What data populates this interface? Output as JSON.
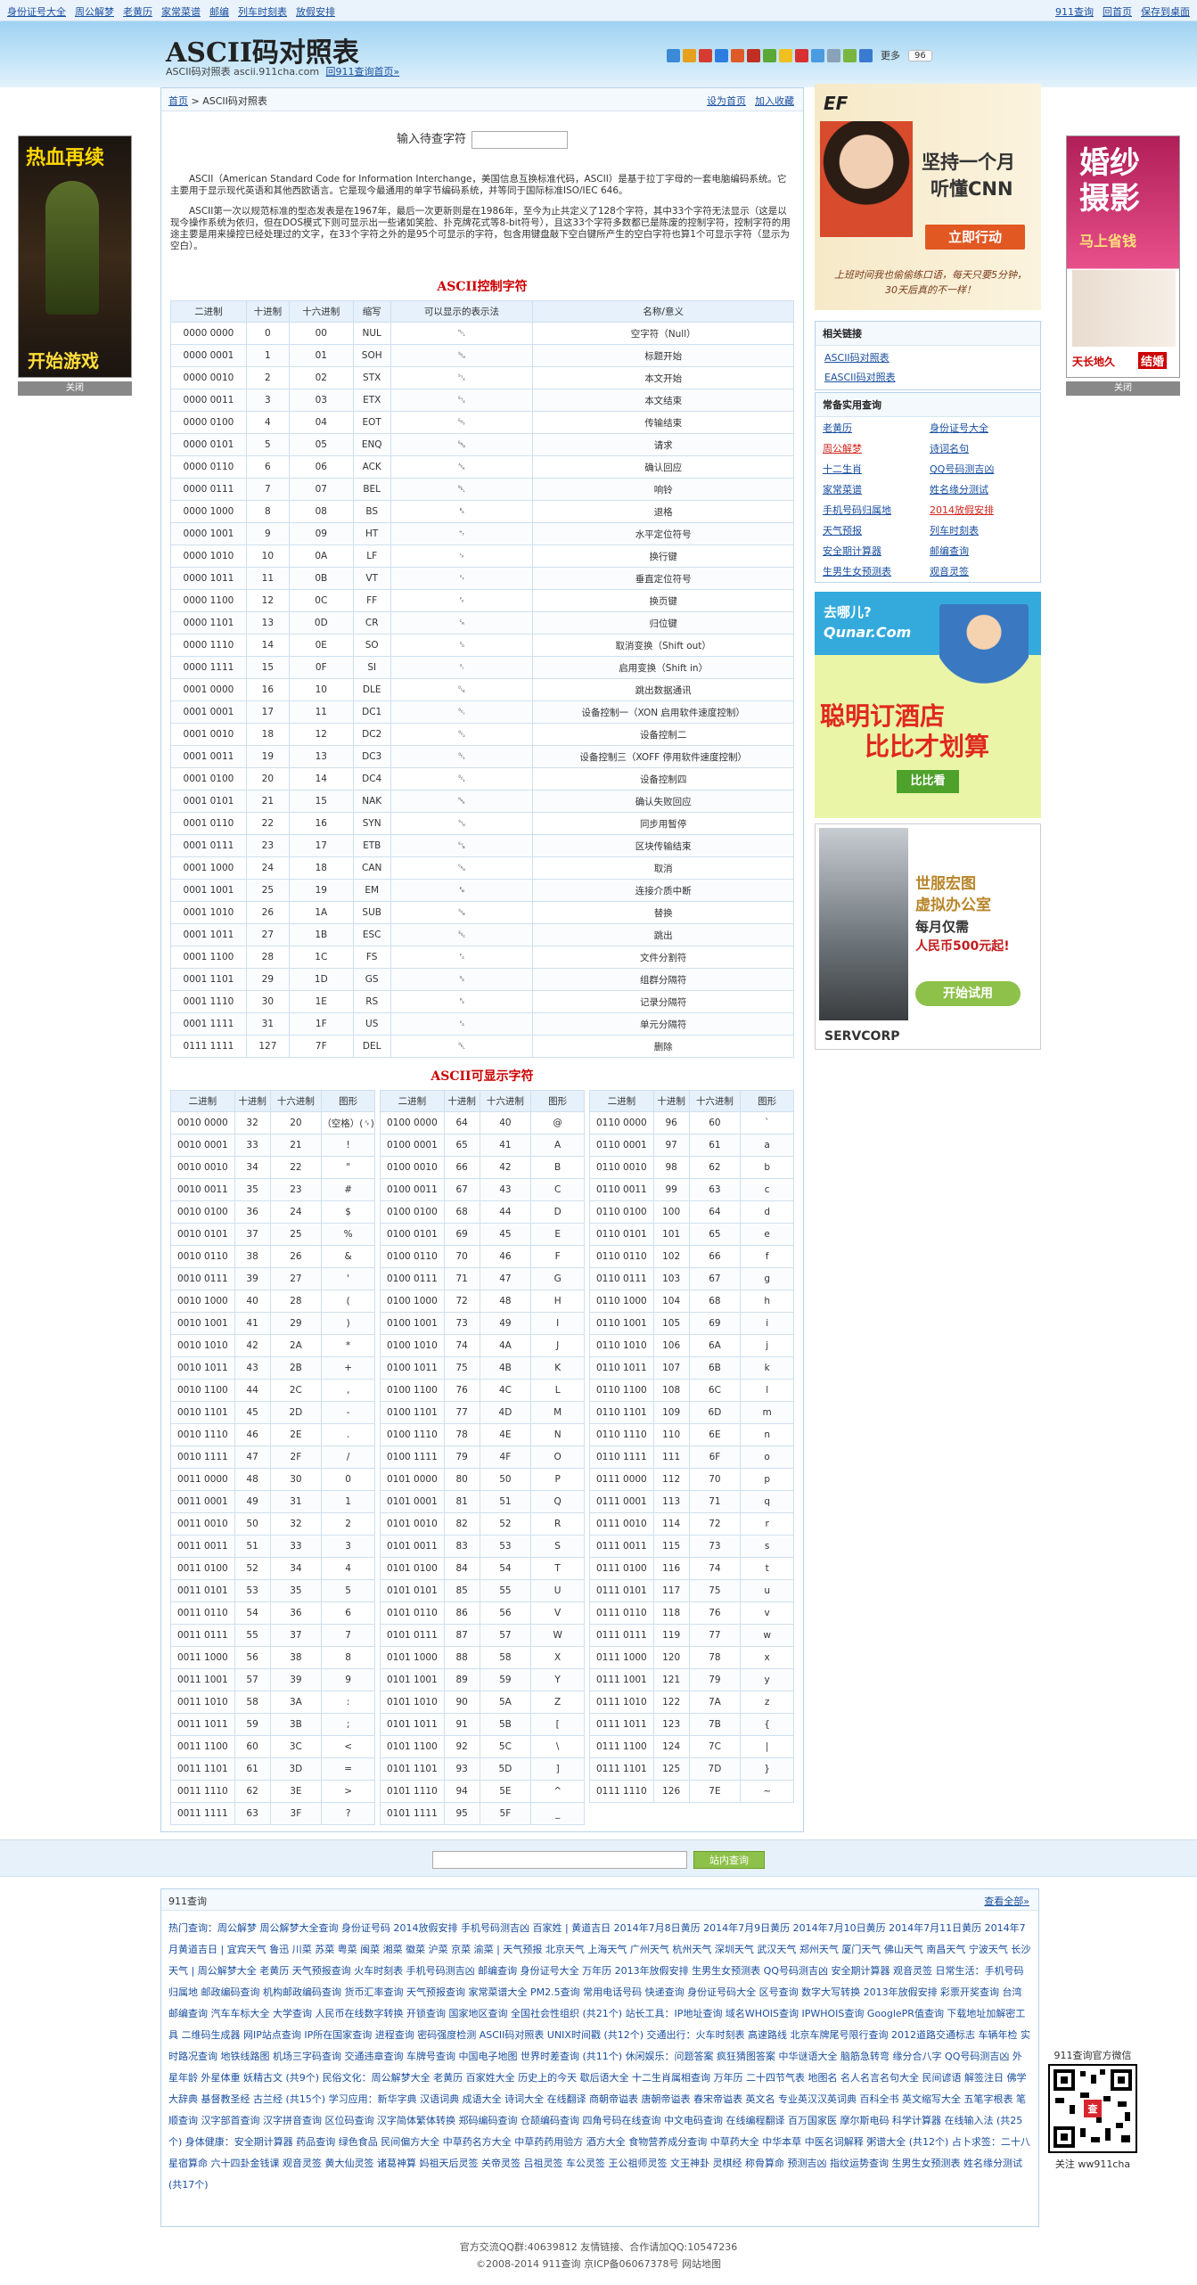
{
  "topbar": {
    "left_links": [
      "身份证号大全",
      "周公解梦",
      "老黄历",
      "家常菜谱",
      "邮编",
      "列车时刻表",
      "放假安排"
    ],
    "right_links": [
      "911查询",
      "回首页",
      "保存到桌面"
    ]
  },
  "header": {
    "title": "ASCII码对照表",
    "subtitle": "ASCII码对照表 ascii.911cha.com",
    "subtitle_link": "回911查询首页»",
    "more_label": "更多",
    "share_count": "96"
  },
  "crumb": {
    "home": "首页",
    "current": " > ASCII码对照表",
    "set_home": "设为首页",
    "favorite": "加入收藏"
  },
  "input": {
    "label": "输入待查字符",
    "value": ""
  },
  "intro": [
    "ASCII（American Standard Code for Information Interchange，美国信息互换标准代码，ASCII）是基于拉丁字母的一套电脑编码系统。它主要用于显示现代英语和其他西欧语言。它是现今最通用的单字节编码系统，并等同于国际标准ISO/IEC 646。",
    "ASCII第一次以规范标准的型态发表是在1967年，最后一次更新则是在1986年，至今为止共定义了128个字符，其中33个字符无法显示（这是以现今操作系统为依归，但在DOS模式下则可显示出一些诸如笑脸、扑克牌花式等8-bit符号），且这33个字符多数都已是陈废的控制字符，控制字符的用途主要是用来操控已经处理过的文字，在33个字符之外的是95个可显示的字符，包含用键盘敲下空白键所产生的空白字符也算1个可显示字符（显示为空白）。"
  ],
  "control": {
    "title": "ASCII控制字符",
    "headers": [
      "二进制",
      "十进制",
      "十六进制",
      "缩写",
      "可以显示的表示法",
      "名称/意义"
    ],
    "rows": [
      [
        "0000 0000",
        "0",
        "00",
        "NUL",
        "␀",
        "空字符（Null）"
      ],
      [
        "0000 0001",
        "1",
        "01",
        "SOH",
        "␁",
        "标题开始"
      ],
      [
        "0000 0010",
        "2",
        "02",
        "STX",
        "␂",
        "本文开始"
      ],
      [
        "0000 0011",
        "3",
        "03",
        "ETX",
        "␃",
        "本文结束"
      ],
      [
        "0000 0100",
        "4",
        "04",
        "EOT",
        "␄",
        "传输结束"
      ],
      [
        "0000 0101",
        "5",
        "05",
        "ENQ",
        "␅",
        "请求"
      ],
      [
        "0000 0110",
        "6",
        "06",
        "ACK",
        "␆",
        "确认回应"
      ],
      [
        "0000 0111",
        "7",
        "07",
        "BEL",
        "␇",
        "响铃"
      ],
      [
        "0000 1000",
        "8",
        "08",
        "BS",
        "␈",
        "退格"
      ],
      [
        "0000 1001",
        "9",
        "09",
        "HT",
        "␉",
        "水平定位符号"
      ],
      [
        "0000 1010",
        "10",
        "0A",
        "LF",
        "␊",
        "换行键"
      ],
      [
        "0000 1011",
        "11",
        "0B",
        "VT",
        "␋",
        "垂直定位符号"
      ],
      [
        "0000 1100",
        "12",
        "0C",
        "FF",
        "␌",
        "换页键"
      ],
      [
        "0000 1101",
        "13",
        "0D",
        "CR",
        "␍",
        "归位键"
      ],
      [
        "0000 1110",
        "14",
        "0E",
        "SO",
        "␎",
        "取消变换（Shift out）"
      ],
      [
        "0000 1111",
        "15",
        "0F",
        "SI",
        "␏",
        "启用变换（Shift in）"
      ],
      [
        "0001 0000",
        "16",
        "10",
        "DLE",
        "␐",
        "跳出数据通讯"
      ],
      [
        "0001 0001",
        "17",
        "11",
        "DC1",
        "␑",
        "设备控制一（XON 启用软件速度控制）"
      ],
      [
        "0001 0010",
        "18",
        "12",
        "DC2",
        "␒",
        "设备控制二"
      ],
      [
        "0001 0011",
        "19",
        "13",
        "DC3",
        "␓",
        "设备控制三（XOFF 停用软件速度控制）"
      ],
      [
        "0001 0100",
        "20",
        "14",
        "DC4",
        "␔",
        "设备控制四"
      ],
      [
        "0001 0101",
        "21",
        "15",
        "NAK",
        "␕",
        "确认失败回应"
      ],
      [
        "0001 0110",
        "22",
        "16",
        "SYN",
        "␖",
        "同步用暂停"
      ],
      [
        "0001 0111",
        "23",
        "17",
        "ETB",
        "␗",
        "区块传输结束"
      ],
      [
        "0001 1000",
        "24",
        "18",
        "CAN",
        "␘",
        "取消"
      ],
      [
        "0001 1001",
        "25",
        "19",
        "EM",
        "␙",
        "连接介质中断"
      ],
      [
        "0001 1010",
        "26",
        "1A",
        "SUB",
        "␚",
        "替换"
      ],
      [
        "0001 1011",
        "27",
        "1B",
        "ESC",
        "␛",
        "跳出"
      ],
      [
        "0001 1100",
        "28",
        "1C",
        "FS",
        "␜",
        "文件分割符"
      ],
      [
        "0001 1101",
        "29",
        "1D",
        "GS",
        "␝",
        "组群分隔符"
      ],
      [
        "0001 1110",
        "30",
        "1E",
        "RS",
        "␞",
        "记录分隔符"
      ],
      [
        "0001 1111",
        "31",
        "1F",
        "US",
        "␟",
        "单元分隔符"
      ],
      [
        "0111 1111",
        "127",
        "7F",
        "DEL",
        "␡",
        "删除"
      ]
    ]
  },
  "printable": {
    "title": "ASCII可显示字符",
    "headers": [
      "二进制",
      "十进制",
      "十六进制",
      "图形"
    ],
    "col1": [
      [
        "0010 0000",
        "32",
        "20",
        "（空格）(␠)"
      ],
      [
        "0010 0001",
        "33",
        "21",
        "!"
      ],
      [
        "0010 0010",
        "34",
        "22",
        "\""
      ],
      [
        "0010 0011",
        "35",
        "23",
        "#"
      ],
      [
        "0010 0100",
        "36",
        "24",
        "$"
      ],
      [
        "0010 0101",
        "37",
        "25",
        "%"
      ],
      [
        "0010 0110",
        "38",
        "26",
        "&"
      ],
      [
        "0010 0111",
        "39",
        "27",
        "'"
      ],
      [
        "0010 1000",
        "40",
        "28",
        "("
      ],
      [
        "0010 1001",
        "41",
        "29",
        ")"
      ],
      [
        "0010 1010",
        "42",
        "2A",
        "*"
      ],
      [
        "0010 1011",
        "43",
        "2B",
        "+"
      ],
      [
        "0010 1100",
        "44",
        "2C",
        ","
      ],
      [
        "0010 1101",
        "45",
        "2D",
        "-"
      ],
      [
        "0010 1110",
        "46",
        "2E",
        "."
      ],
      [
        "0010 1111",
        "47",
        "2F",
        "/"
      ],
      [
        "0011 0000",
        "48",
        "30",
        "0"
      ],
      [
        "0011 0001",
        "49",
        "31",
        "1"
      ],
      [
        "0011 0010",
        "50",
        "32",
        "2"
      ],
      [
        "0011 0011",
        "51",
        "33",
        "3"
      ],
      [
        "0011 0100",
        "52",
        "34",
        "4"
      ],
      [
        "0011 0101",
        "53",
        "35",
        "5"
      ],
      [
        "0011 0110",
        "54",
        "36",
        "6"
      ],
      [
        "0011 0111",
        "55",
        "37",
        "7"
      ],
      [
        "0011 1000",
        "56",
        "38",
        "8"
      ],
      [
        "0011 1001",
        "57",
        "39",
        "9"
      ],
      [
        "0011 1010",
        "58",
        "3A",
        ":"
      ],
      [
        "0011 1011",
        "59",
        "3B",
        ";"
      ],
      [
        "0011 1100",
        "60",
        "3C",
        "<"
      ],
      [
        "0011 1101",
        "61",
        "3D",
        "="
      ],
      [
        "0011 1110",
        "62",
        "3E",
        ">"
      ],
      [
        "0011 1111",
        "63",
        "3F",
        "?"
      ]
    ],
    "col2": [
      [
        "0100 0000",
        "64",
        "40",
        "@"
      ],
      [
        "0100 0001",
        "65",
        "41",
        "A"
      ],
      [
        "0100 0010",
        "66",
        "42",
        "B"
      ],
      [
        "0100 0011",
        "67",
        "43",
        "C"
      ],
      [
        "0100 0100",
        "68",
        "44",
        "D"
      ],
      [
        "0100 0101",
        "69",
        "45",
        "E"
      ],
      [
        "0100 0110",
        "70",
        "46",
        "F"
      ],
      [
        "0100 0111",
        "71",
        "47",
        "G"
      ],
      [
        "0100 1000",
        "72",
        "48",
        "H"
      ],
      [
        "0100 1001",
        "73",
        "49",
        "I"
      ],
      [
        "0100 1010",
        "74",
        "4A",
        "J"
      ],
      [
        "0100 1011",
        "75",
        "4B",
        "K"
      ],
      [
        "0100 1100",
        "76",
        "4C",
        "L"
      ],
      [
        "0100 1101",
        "77",
        "4D",
        "M"
      ],
      [
        "0100 1110",
        "78",
        "4E",
        "N"
      ],
      [
        "0100 1111",
        "79",
        "4F",
        "O"
      ],
      [
        "0101 0000",
        "80",
        "50",
        "P"
      ],
      [
        "0101 0001",
        "81",
        "51",
        "Q"
      ],
      [
        "0101 0010",
        "82",
        "52",
        "R"
      ],
      [
        "0101 0011",
        "83",
        "53",
        "S"
      ],
      [
        "0101 0100",
        "84",
        "54",
        "T"
      ],
      [
        "0101 0101",
        "85",
        "55",
        "U"
      ],
      [
        "0101 0110",
        "86",
        "56",
        "V"
      ],
      [
        "0101 0111",
        "87",
        "57",
        "W"
      ],
      [
        "0101 1000",
        "88",
        "58",
        "X"
      ],
      [
        "0101 1001",
        "89",
        "59",
        "Y"
      ],
      [
        "0101 1010",
        "90",
        "5A",
        "Z"
      ],
      [
        "0101 1011",
        "91",
        "5B",
        "["
      ],
      [
        "0101 1100",
        "92",
        "5C",
        "\\"
      ],
      [
        "0101 1101",
        "93",
        "5D",
        "]"
      ],
      [
        "0101 1110",
        "94",
        "5E",
        "^"
      ],
      [
        "0101 1111",
        "95",
        "5F",
        "_"
      ]
    ],
    "col3": [
      [
        "0110 0000",
        "96",
        "60",
        "`"
      ],
      [
        "0110 0001",
        "97",
        "61",
        "a"
      ],
      [
        "0110 0010",
        "98",
        "62",
        "b"
      ],
      [
        "0110 0011",
        "99",
        "63",
        "c"
      ],
      [
        "0110 0100",
        "100",
        "64",
        "d"
      ],
      [
        "0110 0101",
        "101",
        "65",
        "e"
      ],
      [
        "0110 0110",
        "102",
        "66",
        "f"
      ],
      [
        "0110 0111",
        "103",
        "67",
        "g"
      ],
      [
        "0110 1000",
        "104",
        "68",
        "h"
      ],
      [
        "0110 1001",
        "105",
        "69",
        "i"
      ],
      [
        "0110 1010",
        "106",
        "6A",
        "j"
      ],
      [
        "0110 1011",
        "107",
        "6B",
        "k"
      ],
      [
        "0110 1100",
        "108",
        "6C",
        "l"
      ],
      [
        "0110 1101",
        "109",
        "6D",
        "m"
      ],
      [
        "0110 1110",
        "110",
        "6E",
        "n"
      ],
      [
        "0110 1111",
        "111",
        "6F",
        "o"
      ],
      [
        "0111 0000",
        "112",
        "70",
        "p"
      ],
      [
        "0111 0001",
        "113",
        "71",
        "q"
      ],
      [
        "0111 0010",
        "114",
        "72",
        "r"
      ],
      [
        "0111 0011",
        "115",
        "73",
        "s"
      ],
      [
        "0111 0100",
        "116",
        "74",
        "t"
      ],
      [
        "0111 0101",
        "117",
        "75",
        "u"
      ],
      [
        "0111 0110",
        "118",
        "76",
        "v"
      ],
      [
        "0111 0111",
        "119",
        "77",
        "w"
      ],
      [
        "0111 1000",
        "120",
        "78",
        "x"
      ],
      [
        "0111 1001",
        "121",
        "79",
        "y"
      ],
      [
        "0111 1010",
        "122",
        "7A",
        "z"
      ],
      [
        "0111 1011",
        "123",
        "7B",
        "{"
      ],
      [
        "0111 1100",
        "124",
        "7C",
        "|"
      ],
      [
        "0111 1101",
        "125",
        "7D",
        "}"
      ],
      [
        "0111 1110",
        "126",
        "7E",
        "~"
      ]
    ]
  },
  "left_ad": {
    "top": "热血再续",
    "bottom": "开始游戏",
    "close": "关闭"
  },
  "right_ad": {
    "line1": "婚纱",
    "line2": "摄影",
    "sub": "马上省钱",
    "brand": "天长地久",
    "tag": "结婚",
    "close": "关闭"
  },
  "ad_ef": {
    "brand": "EF",
    "line1": "坚持一个月",
    "line2": "听懂CNN",
    "button": "立即行动",
    "caption": "上班时间我也偷偷练口语，每天只要5分钟，30天后真的不一样！"
  },
  "related": {
    "title": "相关链接",
    "links": [
      "ASCII码对照表",
      "EASCII码对照表"
    ]
  },
  "tools": {
    "title": "常备实用查询",
    "links": [
      "老黄历",
      "身份证号大全",
      "周公解梦",
      "诗词名句",
      "十二生肖",
      "QQ号码测吉凶",
      "家常菜谱",
      "姓名缘分测试",
      "手机号码归属地",
      "2014放假安排",
      "天气预报",
      "列车时刻表",
      "安全期计算器",
      "邮编查询",
      "生男生女预测表",
      "观音灵签"
    ]
  },
  "ad_qunar": {
    "top": "去哪儿?",
    "brand": "Qunar.Com",
    "line1": "聪明订酒店",
    "line2": "比比才划算",
    "button": "比比看"
  },
  "ad_servcorp": {
    "line1": "世服宏图",
    "line2": "虚拟办公室",
    "line3": "每月仅需",
    "line4": "人民币500元起!",
    "button": "开始试用",
    "brand": "SERVCORP"
  },
  "footer_search": {
    "placeholder": "",
    "button": "站内查询"
  },
  "friend": {
    "title": "911查询",
    "more": "查看全部»",
    "lines": [
      "热门查询：周公解梦 周公解梦大全查询 身份证号码 2014放假安排 手机号码测吉凶 百家姓 | 黄道吉日 2014年7月8日黄历 2014年7月9日黄历 2014年7月10日黄历 2014年7月11日黄历 2014年7月黄道吉日 | 宜宾天气 鲁迅 川菜 苏菜 粤菜 闽菜 湘菜 徽菜 沪菜 京菜 渝菜 | 天气预报 北京天气 上海天气 广州天气 杭州天气 深圳天气 武汉天气 郑州天气 厦门天气 佛山天气 南昌天气 宁波天气 长沙天气 | 周公解梦大全 老黄历 天气预报查询 火车时刻表 手机号码测吉凶 邮编查询 身份证号大全 万年历 2013年放假安排 生男生女预测表 QQ号码测吉凶 安全期计算器 观音灵签",
      "日常生活：手机号码归属地 邮政编码查询 机构邮政编码查询 货币汇率查询 天气预报查询 家常菜谱大全 PM2.5查询 常用电话号码 快递查询 身份证号码大全 区号查询 数字大写转换 2013年放假安排 彩票开奖查询 台湾邮编查询 汽车车标大全 大学查询 人民币在线数字转换 开锁查询 国家地区查询 全国社会性组织 (共21个)",
      "站长工具：IP地址查询 域名WHOIS查询 IPWHOIS查询 GooglePR值查询 下载地址加解密工具 二维码生成器 网IP站点查询 IP所在国家查询 进程查询 密码强度检测 ASCII码对照表 UNIX时间戳 (共12个)",
      "交通出行：火车时刻表 高速路线 北京车牌尾号限行查询 2012道路交通标志 车辆年检 实时路况查询 地铁线路图 机场三字码查询 交通违章查询 车牌号查询 中国电子地图 世界时差查询 (共11个)",
      "休闲娱乐：问题答案 疯狂猜图答案 中华谜语大全 脑筋急转弯 缘分合八字 QQ号码测吉凶 外星年龄 外星体重 妖精古文 (共9个)",
      "民俗文化：周公解梦大全 老黄历 百家姓大全 历史上的今天 歇后语大全 十二生肖属相查询 万年历 二十四节气表 地图名 名人名言名句大全 民间谚语 解签注日 佛学大辞典 基督教圣经 古兰经 (共15个)",
      "学习应用：新华字典 汉语词典 成语大全 诗词大全 在线翻译 商朝帝谥表 唐朝帝谥表 春宋帝谥表 英文名 专业英汉汉英词典 百科全书 英文缩写大全 五笔字根表 笔顺查询 汉字部首查询 汉字拼音查询 区位码查询 汉字简体繁体转换 郑码编码查询 仓颉编码查询 四角号码在线查询 中文电码查询 在线编程翻译 百万国家医 摩尔斯电码 科学计算器 在线输入法 (共25个)",
      "身体健康：安全期计算器 药品查询 绿色食品 民间偏方大全 中草药名方大全 中草药药用验方 酒方大全 食物营养成分查询 中草药大全 中华本草 中医名词解释 粥谱大全 (共12个)",
      "占卜求签：二十八星宿算命 六十四卦金钱课 观音灵签 黄大仙灵签 诸葛神算 妈祖天后灵签 关帝灵签 吕祖灵签 车公灵签 王公祖师灵签 文王神卦 灵棋经 称骨算命 预测吉凶 指纹运势查询 生男生女预测表 姓名缘分测试 (共17个)"
    ]
  },
  "qr": {
    "caption": "911查询官方微信",
    "logo": "查",
    "id": "关注  ww911cha"
  },
  "copyright": {
    "line1": "官方交流QQ群:40639812   友情链接、合作请加QQ:10547236",
    "line2": "©2008-2014 911查询 京ICP备06067378号 网站地图"
  }
}
